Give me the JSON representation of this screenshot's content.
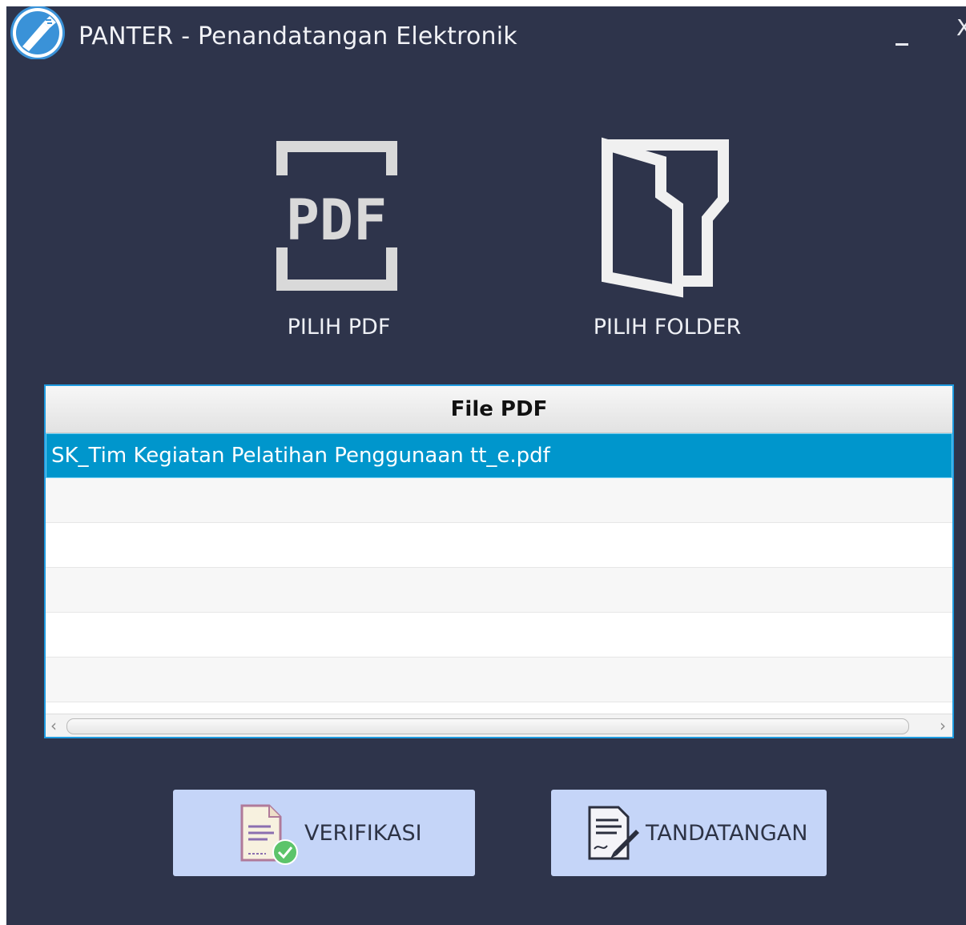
{
  "window": {
    "title": "PANTER - Penandatangan Elektronik",
    "minimize_label": "–",
    "close_label": "X"
  },
  "choices": {
    "pdf_icon_text": "PDF",
    "pdf_label": "PILIH PDF",
    "folder_label": "PILIH FOLDER"
  },
  "table": {
    "header": "File PDF",
    "rows": [
      "SK_Tim Kegiatan Pelatihan Penggunaan  tt_e.pdf",
      "",
      "",
      "",
      "",
      ""
    ],
    "selected_row": 0
  },
  "actions": {
    "verify_label": "VERIFIKASI",
    "sign_label": "TANDATANGAN"
  },
  "colors": {
    "background": "#2e344b",
    "selection": "#0096cc",
    "table_border": "#1f9be0",
    "action_button": "#c5d5f8"
  }
}
